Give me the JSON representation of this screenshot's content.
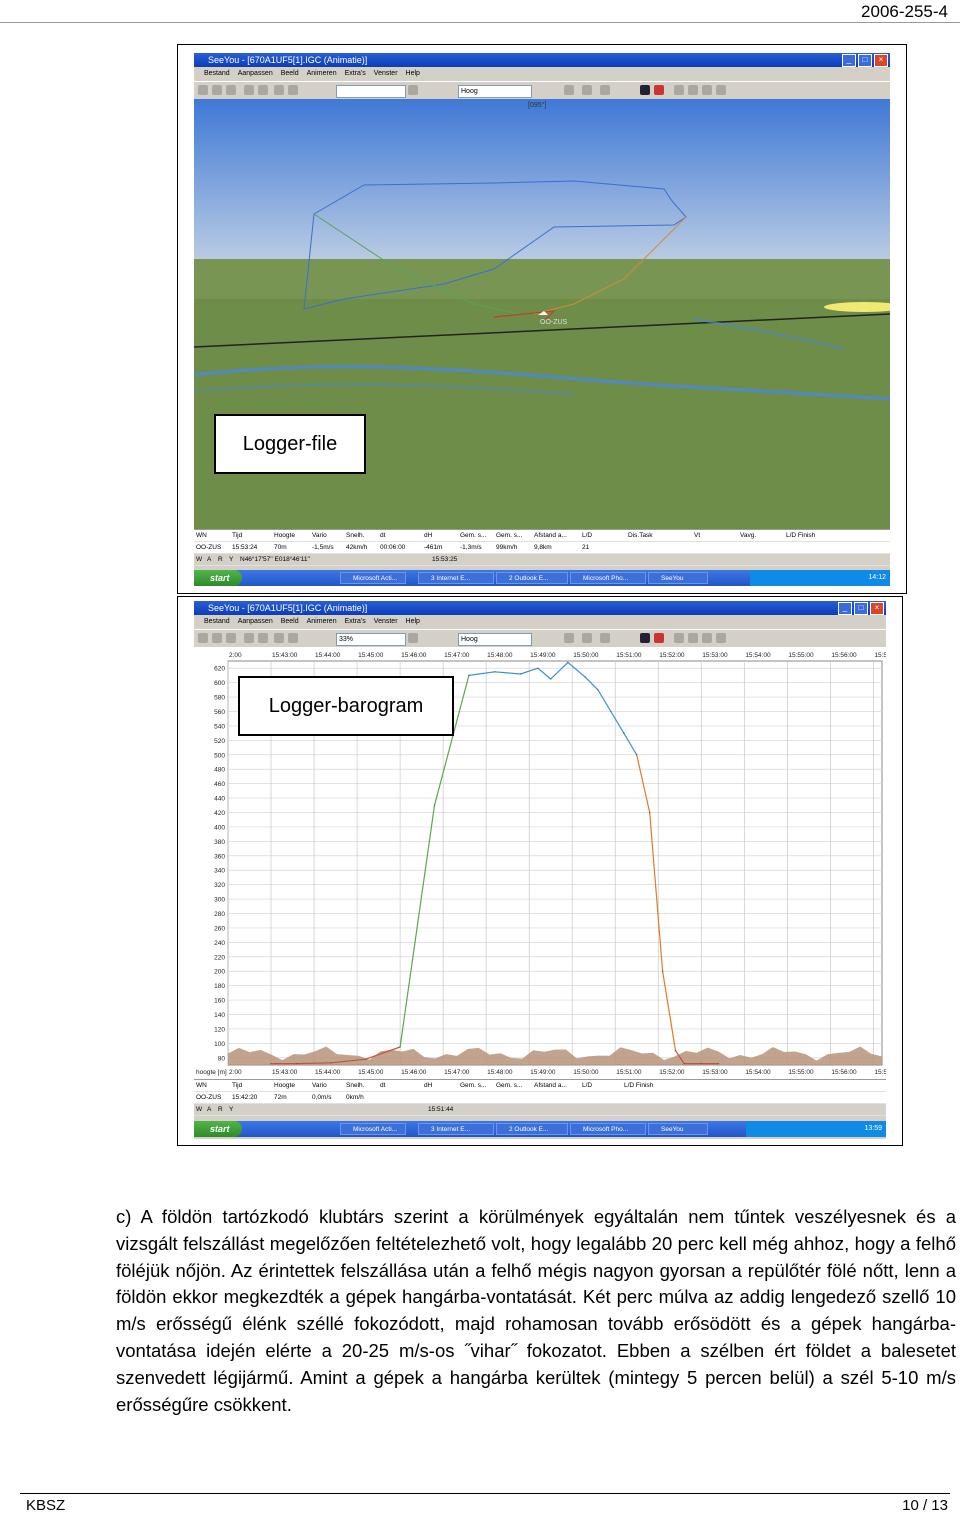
{
  "header": {
    "code": "2006-255-4"
  },
  "top_screenshot": {
    "window_title": "SeeYou - [670A1UF5[1].IGC (Animatie)]",
    "menu": [
      "Bestand",
      "Aanpassen",
      "Beeld",
      "Animeren",
      "Extra's",
      "Venster",
      "Help"
    ],
    "view_combo": "Hoog",
    "heading_label": "[095°]",
    "glider_label": "OO-ZUS",
    "caption": "Logger-file",
    "stat_headers": [
      "WN",
      "Tijd",
      "Hoogte",
      "Vario",
      "Snelh.",
      "dt",
      "dH",
      "Gem. s...",
      "Gem. s...",
      "Afstand a...",
      "L/D",
      "Dis.Task",
      "Vt",
      "Vavg.",
      "L/D Finish"
    ],
    "stat_values": [
      "OO-ZUS",
      "15:53:24",
      "70m",
      "-1,5m/s",
      "42km/h",
      "00:06:00",
      "-461m",
      "-1,3m/s",
      "99km/h",
      "9,8km",
      "21"
    ],
    "position_row": [
      "W",
      "A",
      "R",
      "Y",
      "N46°17'57'' E018°46'11''",
      "15:53:25"
    ],
    "taskbar": {
      "start": "start",
      "buttons": [
        "Microsoft Acti...",
        "3 Internet E...",
        "2 Outlook E...",
        "Microsoft Pho...",
        "SeeYou"
      ],
      "clock": "14:12"
    }
  },
  "bottom_screenshot": {
    "window_title": "SeeYou - [670A1UF5[1].IGC (Animatie)]",
    "menu": [
      "Bestand",
      "Aanpassen",
      "Beeld",
      "Animeren",
      "Extra's",
      "Venster",
      "Help"
    ],
    "zoom_combo": "33%",
    "view_combo": "Hoog",
    "caption": "Logger-barogram",
    "axis_left_caption": "hoogte [m]",
    "stat_headers": [
      "WN",
      "Tijd",
      "Hoogte",
      "Vario",
      "Snelh.",
      "dt",
      "dH",
      "Gem. s...",
      "Gem. s...",
      "Afstand a...",
      "L/D",
      "L/D Finish"
    ],
    "stat_values": [
      "OO-ZUS",
      "15:42:20",
      "72m",
      "0,0m/s",
      "0km/h"
    ],
    "position_row": [
      "W",
      "A",
      "R",
      "Y",
      "15:51:44"
    ],
    "taskbar": {
      "start": "start",
      "buttons": [
        "Microsoft Acti...",
        "3 Internet E...",
        "2 Outlook E...",
        "Microsoft Pho...",
        "SeeYou"
      ],
      "clock": "13:59"
    }
  },
  "chart_data": {
    "type": "line",
    "title": "",
    "xlabel": "",
    "ylabel": "hoogte [m]",
    "x_ticks": [
      "2:00",
      "15:43:00",
      "15:44:00",
      "15:45:00",
      "15:46:00",
      "15:47:00",
      "15:48:00",
      "15:49:00",
      "15:50:00",
      "15:51:00",
      "15:52:00",
      "15:53:00",
      "15:54:00",
      "15:55:00",
      "15:56:00",
      "15:57:00"
    ],
    "y_ticks": [
      80,
      100,
      120,
      140,
      160,
      180,
      200,
      220,
      240,
      260,
      280,
      300,
      320,
      340,
      360,
      380,
      400,
      420,
      440,
      460,
      480,
      500,
      520,
      540,
      560,
      580,
      600,
      620
    ],
    "ylim": [
      70,
      630
    ],
    "xlim": [
      42,
      57.2
    ],
    "grid": true,
    "series": [
      {
        "values_x": [
          43.0,
          43.6,
          44.4,
          45.2,
          46.0,
          46.8,
          47.6,
          48.2,
          48.8,
          49.2,
          49.5,
          49.9,
          50.3,
          50.6,
          50.9,
          51.2,
          51.5,
          51.8,
          52.1,
          52.4,
          52.6,
          53.0,
          53.4
        ],
        "values_y": [
          72,
          72,
          73,
          78,
          95,
          430,
          610,
          615,
          612,
          620,
          605,
          628,
          608,
          590,
          560,
          530,
          500,
          420,
          200,
          90,
          72,
          72,
          72
        ]
      }
    ],
    "terrain_note": "Terrain band"
  },
  "text": {
    "paragraph": "c) A földön tartózkodó klubtárs szerint a körülmények egyáltalán nem tűntek veszélyesnek és a vizsgált felszállást megelőzően feltételezhető volt, hogy legalább 20 perc kell még ahhoz, hogy a felhő föléjük nőjön. Az érintettek felszállása után a felhő mégis nagyon gyorsan a repülőtér fölé nőtt, lenn a földön ekkor megkezdték a gépek hangárba-vontatását. Két perc múlva az addig lengedező szellő 10 m/s erősségű élénk széllé fokozódott, majd rohamosan tovább erősödött és a gépek hangárba-vontatása idején elérte a 20-25 m/s-os ˝vihar˝ fokozatot. Ebben a szélben ért földet a balesetet szenvedett légijármű. Amint a gépek a hangárba kerültek (mintegy 5 percen belül) a szél 5-10 m/s erősségűre csökkent."
  },
  "footer": {
    "left": "KBSZ",
    "right": "10 / 13"
  },
  "colors": {
    "sky_top": "#4a7fd8",
    "sky_bottom": "#a9c0df",
    "ground": "#6c8a46",
    "terrain": "#b9967a",
    "xp_blue": "#2456c5"
  }
}
